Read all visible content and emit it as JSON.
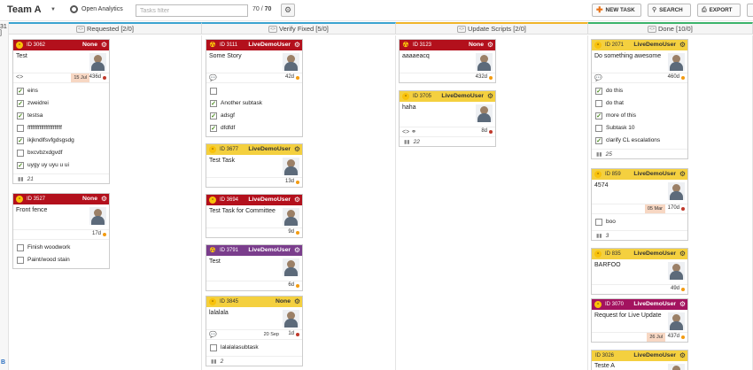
{
  "topbar": {
    "team": "Team A",
    "analytics": "Open Analytics",
    "filter_placeholder": "Tasks filter",
    "count_shown": "70",
    "count_sep": " / ",
    "count_total": "70",
    "new_task": "NEW TASK",
    "search": "SEARCH",
    "export": "EXPORT"
  },
  "edge": {
    "label": "31 ]",
    "bottom": "B"
  },
  "columns": [
    {
      "title": "Requested",
      "count": "[2/0]"
    },
    {
      "title": "Verify Fixed",
      "count": "[5/0]"
    },
    {
      "title": "Update Scripts",
      "count": "[2/0]"
    },
    {
      "title": "Done",
      "count": "[10/0]"
    }
  ],
  "cards": {
    "c3062": {
      "id": "ID 3062",
      "owner": "None",
      "title": "Test",
      "due": "15 Jul",
      "age": "436d",
      "subtasks": [
        {
          "label": "eins",
          "checked": true
        },
        {
          "label": "zweidrei",
          "checked": true
        },
        {
          "label": "testsa",
          "checked": true
        },
        {
          "label": "fffffffffffffffffffffff",
          "checked": false
        },
        {
          "label": "ikjkndlfsvfgdsgsdg",
          "checked": true
        },
        {
          "label": "bxcvbzxdgvdf",
          "checked": false
        },
        {
          "label": "uygy uy uyu u ui",
          "checked": true
        }
      ],
      "footer": "21"
    },
    "c3527": {
      "id": "ID 3527",
      "owner": "None",
      "title": "Front fence",
      "age": "17d",
      "subtasks": [
        {
          "label": "Finish woodwork",
          "checked": false
        },
        {
          "label": "Paint/wood stain",
          "checked": false
        }
      ]
    },
    "c3111": {
      "id": "ID 3111",
      "owner": "LiveDemoUser",
      "title": "Some Story",
      "age": "42d",
      "subtasks": [
        {
          "label": "",
          "checked": false
        },
        {
          "label": "Another subtask",
          "checked": true
        },
        {
          "label": "adsgf",
          "checked": true
        },
        {
          "label": "dfdfdf",
          "checked": true
        }
      ]
    },
    "c3677": {
      "id": "ID 3677",
      "owner": "LiveDemoUser",
      "title": "Test Task",
      "age": "13d"
    },
    "c3694": {
      "id": "ID 3694",
      "owner": "LiveDemoUser",
      "title": "Test Task for Committee",
      "age": "9d"
    },
    "c3791": {
      "id": "ID 3791",
      "owner": "LiveDemoUser",
      "title": "Test",
      "age": "6d"
    },
    "c3845": {
      "id": "ID 3845",
      "owner": "None",
      "title": "lalalala",
      "due": "20 Sep",
      "age": "1d",
      "subtasks": [
        {
          "label": "lalalalasubtask",
          "checked": false
        }
      ],
      "footer": "2"
    },
    "c3123": {
      "id": "ID 3123",
      "owner": "None",
      "title": "aaaaeacq",
      "age": "432d"
    },
    "c3705": {
      "id": "ID 3705",
      "owner": "LiveDemoUser",
      "title": "haha",
      "age": "8d",
      "footer": "22"
    },
    "c2071": {
      "id": "ID 2071",
      "owner": "LiveDemoUser",
      "title": "Do something awesome",
      "age": "460d",
      "subtasks": [
        {
          "label": "do this",
          "checked": true
        },
        {
          "label": "do that",
          "checked": false
        },
        {
          "label": "more of this",
          "checked": true
        },
        {
          "label": "Subtask 10",
          "checked": false
        },
        {
          "label": "clarify CL escalations",
          "checked": true
        }
      ],
      "footer": "25"
    },
    "c859": {
      "id": "ID 859",
      "owner": "LiveDemoUser",
      "title": "4574",
      "due": "05 Mar",
      "age": "170d",
      "subtasks": [
        {
          "label": "boo",
          "checked": false
        }
      ],
      "footer": "3"
    },
    "c835": {
      "id": "ID 835",
      "owner": "LiveDemoUser",
      "title": "BARFOO",
      "age": "49d"
    },
    "c3070": {
      "id": "ID 3070",
      "owner": "LiveDemoUser",
      "title": "Request for Live Update",
      "due": "26 Jul",
      "age": "437d"
    },
    "c3026": {
      "id": "ID 3026",
      "owner": "LiveDemoUser",
      "title": "Teste A"
    }
  },
  "colors": {
    "red": "#b3101c",
    "yellow": "#f4d03f",
    "purple": "#7a3d8c",
    "magenta": "#a3135f",
    "accent": "#3ba3d0"
  }
}
